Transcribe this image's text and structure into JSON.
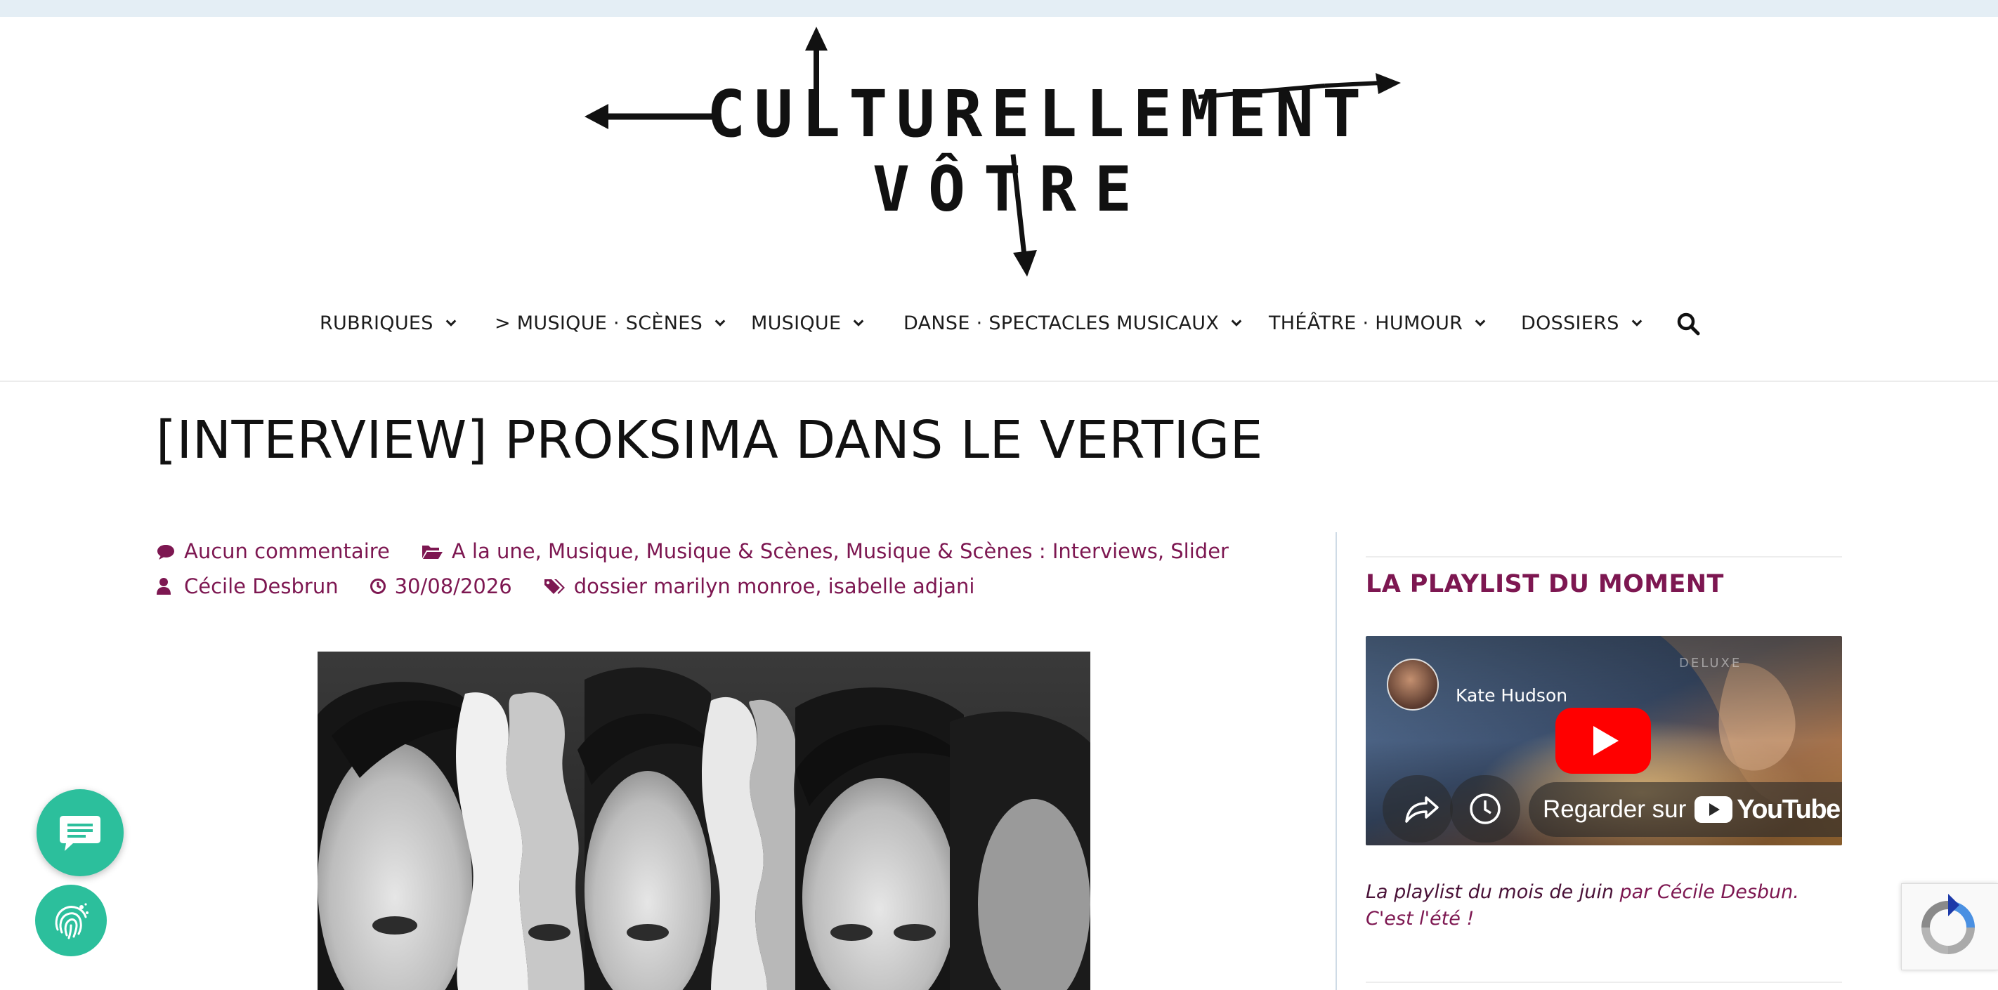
{
  "site": {
    "logo_line1": "CULTURELLEMENT",
    "logo_line2": "VÔTRE"
  },
  "nav": {
    "items": [
      {
        "label": "RUBRIQUES"
      },
      {
        "label": "> MUSIQUE · SCÈNES"
      },
      {
        "label": "MUSIQUE"
      },
      {
        "label": "DANSE · SPECTACLES MUSICAUX"
      },
      {
        "label": "THÉÂTRE · HUMOUR"
      },
      {
        "label": "DOSSIERS"
      }
    ],
    "search_icon": "search-icon"
  },
  "post": {
    "title": "[INTERVIEW] PROKSIMA DANS LE VERTIGE",
    "comments": "Aucun commentaire",
    "categories": [
      "A la une",
      "Musique",
      "Musique & Scènes",
      "Musique & Scènes : Interviews",
      "Slider"
    ],
    "author": "Cécile Desbrun",
    "date": "30/08/2026",
    "tags": [
      "dossier marilyn monroe",
      "isabelle adjani"
    ]
  },
  "sidebar": {
    "widget_title": "LA PLAYLIST DU MOMENT",
    "video": {
      "channel": "Kate Hudson",
      "overlay_text": "DELUXE",
      "watch_label": "Regarder sur",
      "platform": "YouTube"
    },
    "caption_prefix": "La playlist du mois de juin",
    "caption_link": "par Cécile Desbun",
    "caption_suffix": ". C'est l'été !"
  },
  "colors": {
    "accent": "#7d1751",
    "chat": "#2cbf9c",
    "topbar": "#e4eef5"
  },
  "icons": {
    "chat": "chat-bubble-icon",
    "privacy": "fingerprint-icon",
    "recaptcha": "recaptcha-icon"
  }
}
